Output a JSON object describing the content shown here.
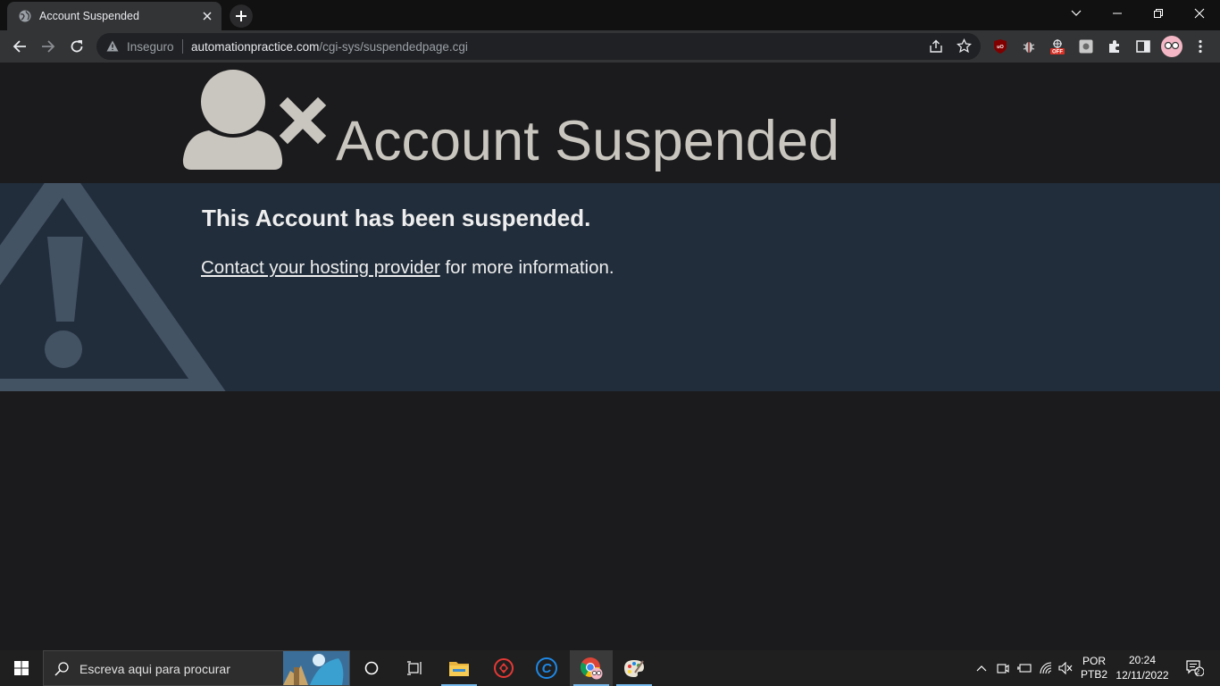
{
  "browser": {
    "tab_title": "Account Suspended",
    "address": {
      "security_label": "Inseguro",
      "host": "automationpractice.com",
      "path": "/cgi-sys/suspendedpage.cgi"
    }
  },
  "page": {
    "title": "Account Suspended",
    "heading": "This Account has been suspended.",
    "link_text": "Contact your hosting provider",
    "trailing_text": " for more information.",
    "colors": {
      "hero_bg": "#1b1b1d",
      "panel_bg": "#212d3b",
      "title_color": "#c9c5bf",
      "text_color": "#eeeeee"
    }
  },
  "taskbar": {
    "search_placeholder": "Escreva aqui para procurar",
    "language": "POR",
    "keyboard": "PTB2",
    "time": "20:24",
    "date": "12/11/2022",
    "notification_count": "2"
  }
}
